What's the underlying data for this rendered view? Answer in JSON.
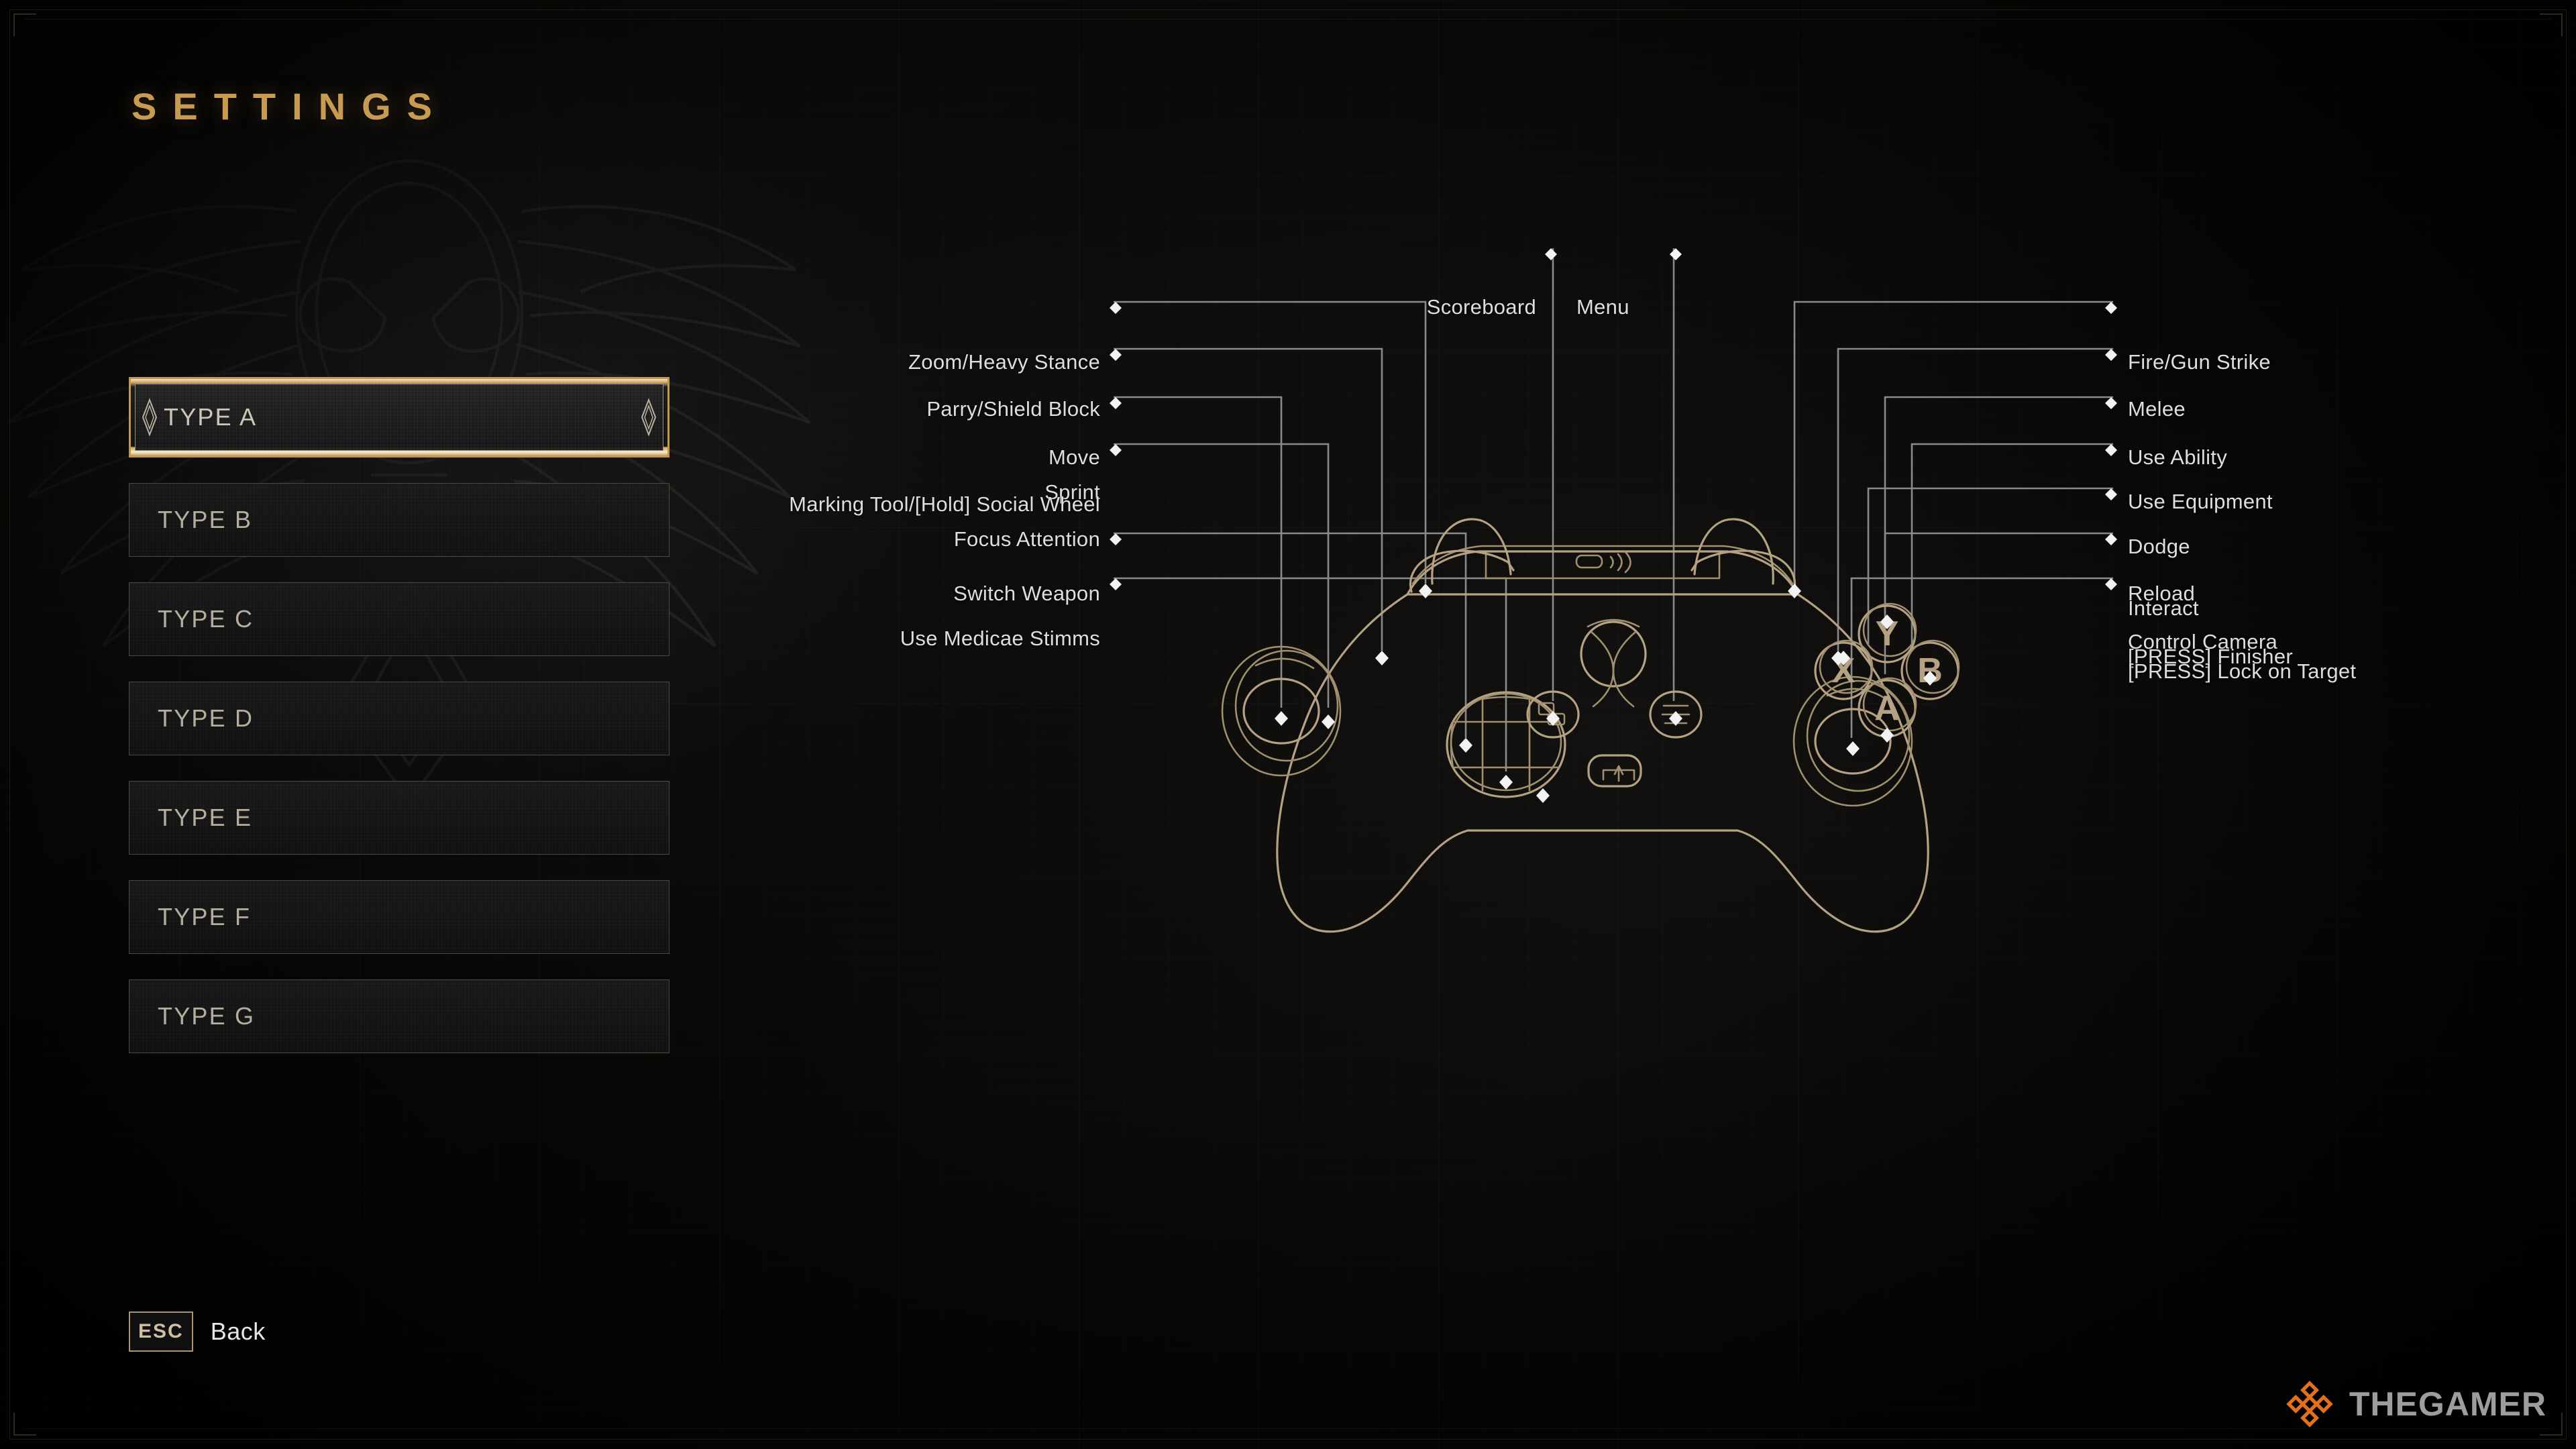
{
  "page": {
    "title": "SETTINGS",
    "accent_gold": "#c79b52",
    "controller_line": "#b5a183",
    "leader_line": "#8a8a8a",
    "label_color": "#dedede"
  },
  "sidebar": {
    "items": [
      {
        "label": "TYPE A",
        "selected": true
      },
      {
        "label": "TYPE B",
        "selected": false
      },
      {
        "label": "TYPE C",
        "selected": false
      },
      {
        "label": "TYPE D",
        "selected": false
      },
      {
        "label": "TYPE E",
        "selected": false
      },
      {
        "label": "TYPE F",
        "selected": false
      },
      {
        "label": "TYPE G",
        "selected": false
      }
    ]
  },
  "controller": {
    "type": "xbox-controller-diagram",
    "labels_top": [
      {
        "name": "scoreboard",
        "text": "Scoreboard"
      },
      {
        "name": "menu",
        "text": "Menu"
      }
    ],
    "labels_left": [
      {
        "name": "zoom-heavy-stance",
        "lines": [
          "Zoom/Heavy Stance"
        ]
      },
      {
        "name": "parry-shield-block",
        "lines": [
          "Parry/Shield Block"
        ]
      },
      {
        "name": "move-sprint",
        "lines": [
          "Move",
          "Sprint"
        ]
      },
      {
        "name": "marking-tool-focus",
        "lines": [
          "Marking Tool/[Hold] Social Wheel",
          "Focus Attention"
        ]
      },
      {
        "name": "switch-weapon",
        "lines": [
          "Switch Weapon"
        ]
      },
      {
        "name": "use-medicae-stimms",
        "lines": [
          "Use Medicae Stimms"
        ]
      }
    ],
    "labels_right": [
      {
        "name": "fire-gun-strike",
        "lines": [
          "Fire/Gun Strike"
        ]
      },
      {
        "name": "melee",
        "lines": [
          "Melee"
        ]
      },
      {
        "name": "use-ability",
        "lines": [
          "Use Ability"
        ]
      },
      {
        "name": "use-equipment",
        "lines": [
          "Use Equipment"
        ]
      },
      {
        "name": "dodge",
        "lines": [
          "Dodge"
        ]
      },
      {
        "name": "reload-interact",
        "lines": [
          "Reload",
          "Interact"
        ]
      },
      {
        "name": "control-camera",
        "lines": [
          "Control Camera",
          "[PRESS] Finisher",
          "[PRESS] Lock on Target"
        ]
      }
    ],
    "face_buttons": [
      "Y",
      "X",
      "B",
      "A"
    ]
  },
  "footer": {
    "key": "ESC",
    "action": "Back"
  },
  "watermark": {
    "text": "THEGAMER",
    "icon_color": "#e2711d"
  }
}
